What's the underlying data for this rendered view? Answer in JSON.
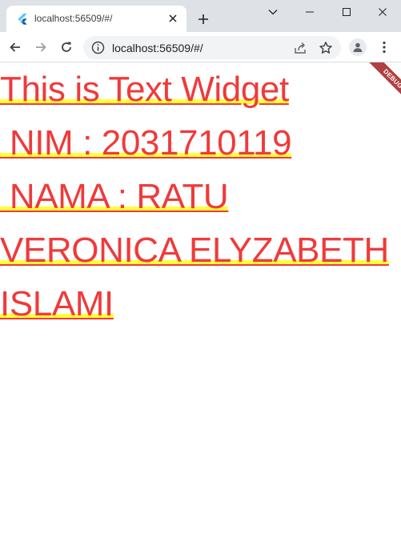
{
  "browser": {
    "tab_title": "localhost:56509/#/",
    "url": "localhost:56509/#/",
    "icons": {
      "favicon": "flutter-icon",
      "tab_close": "close-icon",
      "new_tab": "plus-icon",
      "tab_search": "chevron-down-icon",
      "minimize": "minimize-icon",
      "maximize": "maximize-icon",
      "window_close": "close-icon",
      "back": "arrow-left-icon",
      "forward": "arrow-right-icon",
      "reload": "reload-icon",
      "site_info": "info-icon",
      "share": "share-icon",
      "bookmark": "star-icon",
      "profile": "profile-icon",
      "menu": "kebab-menu-icon"
    }
  },
  "page": {
    "text_lines": [
      "This is Text Widget",
      " NIM : 2031710119",
      " NAMA : RATU",
      "VERONICA ELYZABETH",
      "ISLAMI"
    ],
    "text_color": "#f03a3a",
    "highlight_color": "#ffff3a",
    "debug_banner": "DEBUG"
  }
}
